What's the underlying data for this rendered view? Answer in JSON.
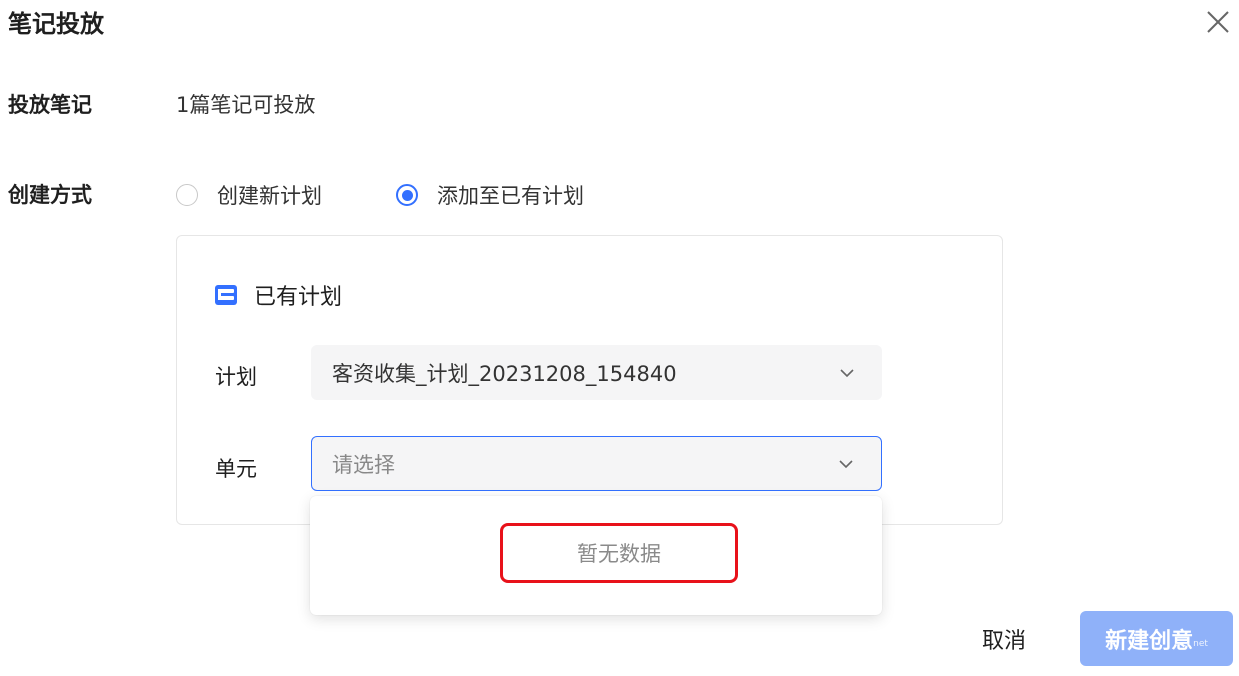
{
  "dialog": {
    "title": "笔记投放"
  },
  "form": {
    "notes_label": "投放笔记",
    "notes_value": "1篇笔记可投放",
    "method_label": "创建方式",
    "method_options": [
      {
        "label": "创建新计划",
        "checked": false
      },
      {
        "label": "添加至已有计划",
        "checked": true
      }
    ]
  },
  "panel": {
    "title": "已有计划",
    "icon": "plan-icon",
    "plan_label": "计划",
    "plan_value": "客资收集_计划_20231208_154840",
    "unit_label": "单元",
    "unit_placeholder": "请选择"
  },
  "dropdown": {
    "empty_text": "暂无数据"
  },
  "footer": {
    "cancel_label": "取消",
    "create_label": "新建创意",
    "watermark": "net"
  },
  "colors": {
    "accent": "#3370ff",
    "primary_disabled": "#8fb1f9",
    "highlight_border": "#e8111a"
  }
}
